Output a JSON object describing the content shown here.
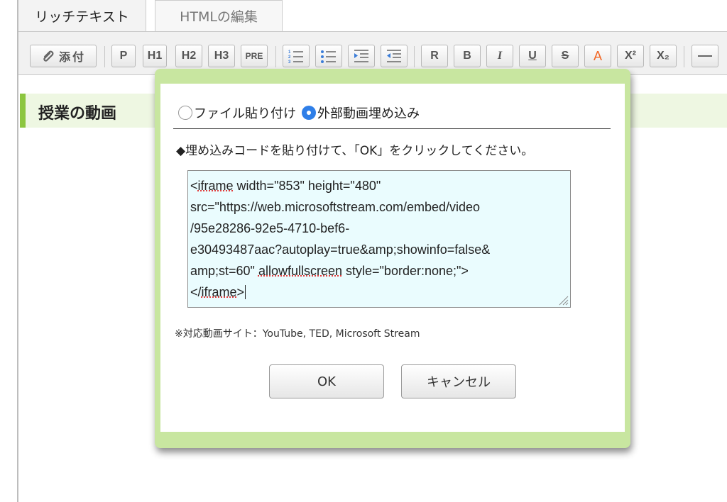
{
  "tabs": [
    {
      "label": "リッチテキスト"
    },
    {
      "label": "HTMLの編集"
    }
  ],
  "toolbar": {
    "buttons": [
      {
        "label": "添付",
        "icon": "paperclip-icon"
      },
      {
        "label": "P"
      },
      {
        "label": "H1"
      },
      {
        "label": "H2"
      },
      {
        "label": "H3"
      },
      {
        "label": "PRE"
      },
      {
        "icon": "ordered-list-icon"
      },
      {
        "icon": "unordered-list-icon"
      },
      {
        "icon": "indent-icon"
      },
      {
        "icon": "outdent-icon"
      },
      {
        "label": "R"
      },
      {
        "label": "B"
      },
      {
        "label": "I"
      },
      {
        "label": "U"
      },
      {
        "label": "S"
      },
      {
        "label": "A"
      },
      {
        "label": "X²"
      },
      {
        "label": "X₂"
      },
      {
        "icon": "horizontal-rule-icon"
      }
    ],
    "colors": {
      "font_color_button": "#f26522"
    }
  },
  "section": {
    "heading": "授業の動画"
  },
  "dialog": {
    "options": [
      {
        "label": "ファイル貼り付け",
        "checked": false
      },
      {
        "label": "外部動画埋め込み",
        "checked": true
      }
    ],
    "instruction": "◆埋め込みコードを貼り付けて、「OK」をクリックしてください。",
    "code": {
      "line1_pre": "<",
      "line1_typo": "iframe",
      "line1_post": " width=\"853\" height=\"480\"",
      "line2": "src=\"https://web.microsoftstream.com/embed/video",
      "line3": "/95e28286-92e5-4710-bef6-",
      "line4": "e30493487aac?autoplay=true&amp;showinfo=false&",
      "line5_pre": "amp;st=60\" ",
      "line5_typo": "allowfullscreen",
      "line5_post": " style=\"border:none;\">",
      "line6_pre": "</",
      "line6_typo": "iframe",
      "line6_post": ">"
    },
    "note": "※対応動画サイト：YouTube, TED, Microsoft Stream",
    "ok_label": "OK",
    "cancel_label": "キャンセル"
  },
  "colors": {
    "dialog_border": "#c8e6a0",
    "code_bg": "#eafcfe",
    "accent_green": "#8cc63f",
    "radio_checked": "#2f7fe8"
  }
}
